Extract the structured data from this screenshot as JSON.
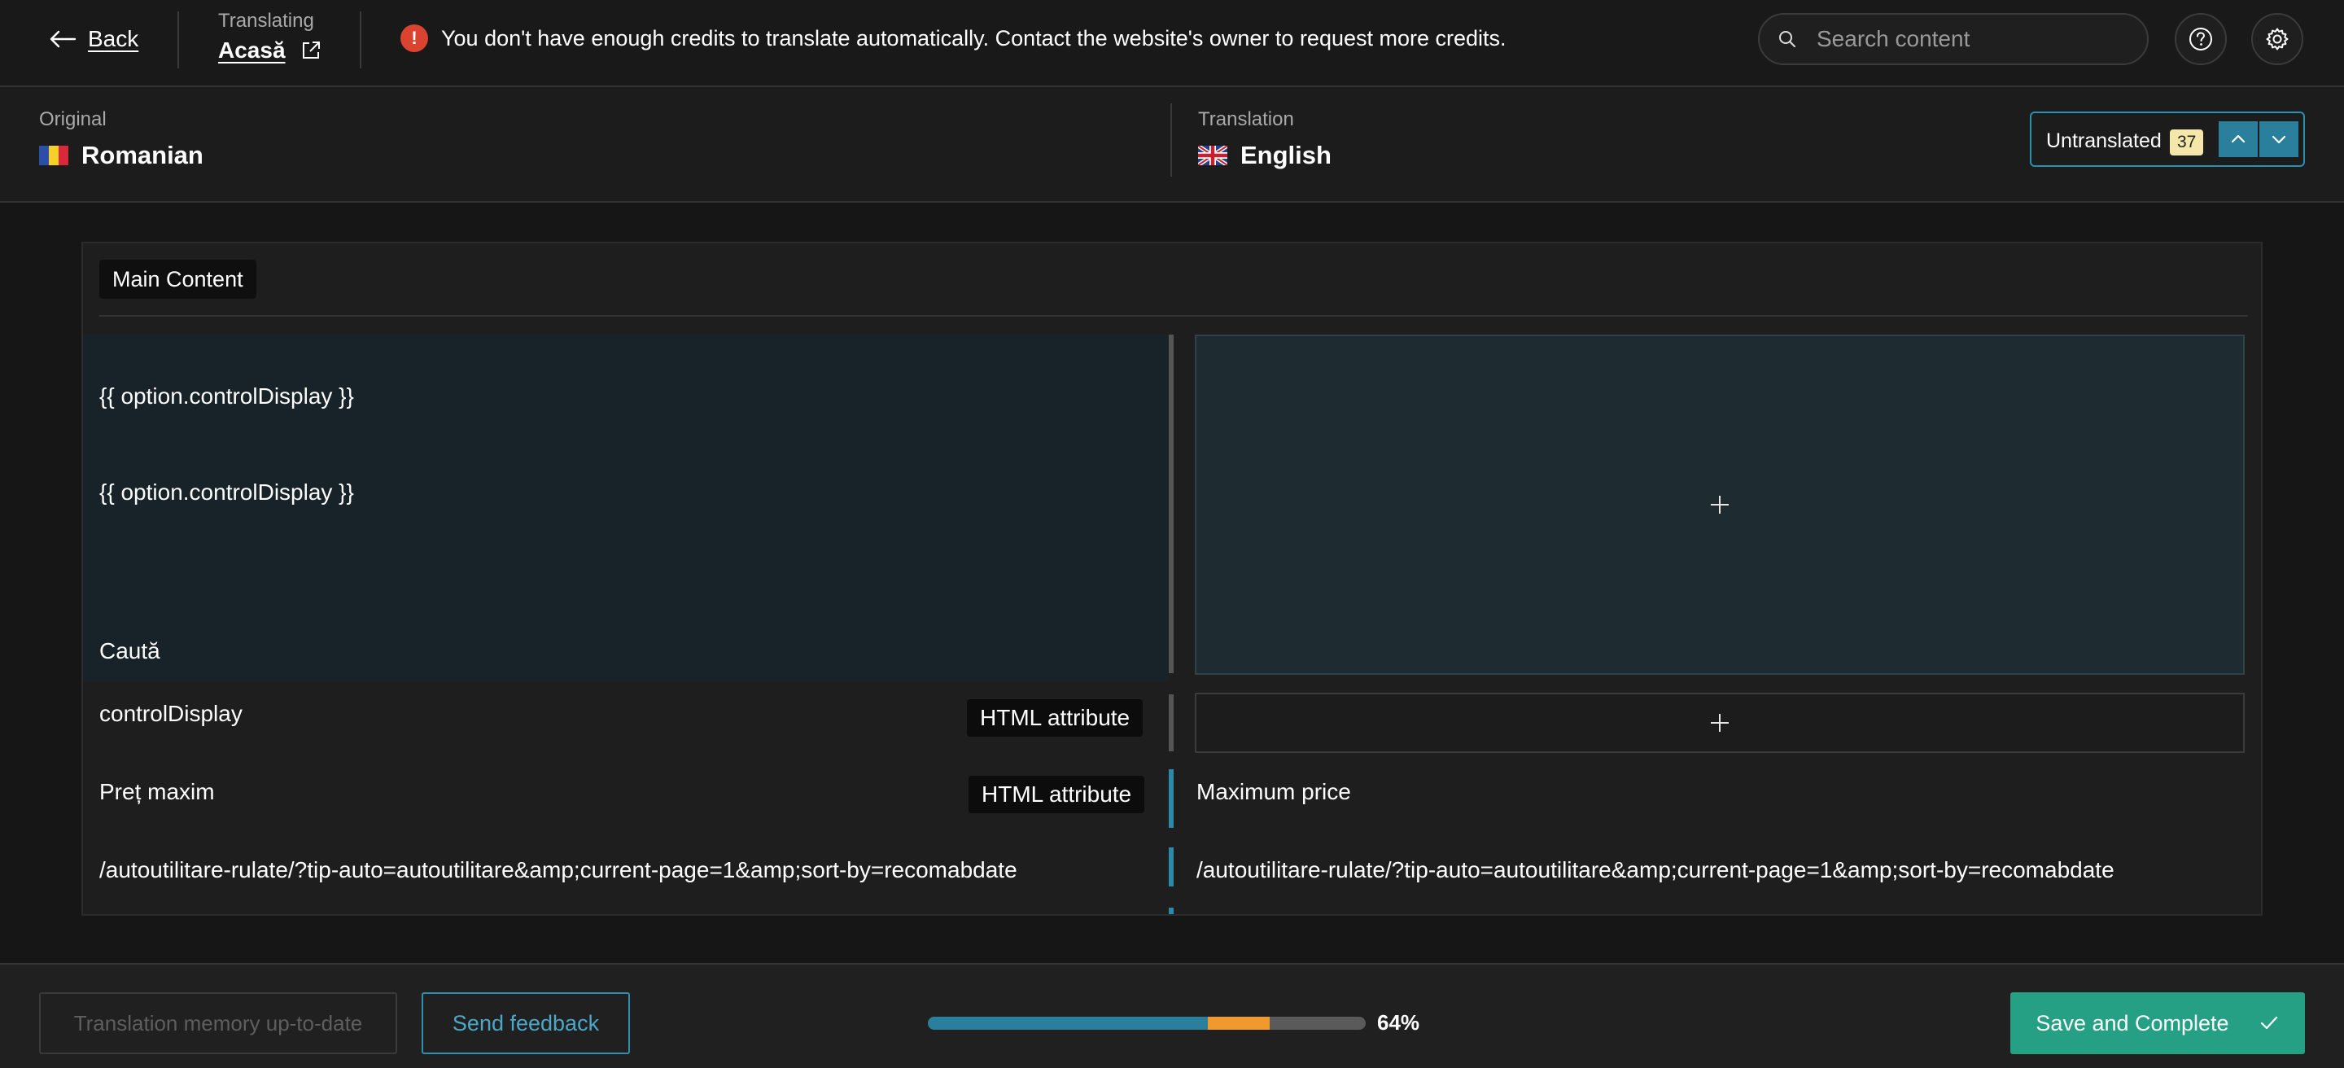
{
  "topbar": {
    "back_label": "Back",
    "translating_label": "Translating",
    "page_name": "Acasă",
    "alert_message": "You don't have enough credits to translate automatically. Contact the website's owner to request more credits.",
    "alert_icon": "!",
    "search_placeholder": "Search content"
  },
  "languages": {
    "original_label": "Original",
    "original_name": "Romanian",
    "translation_label": "Translation",
    "translation_name": "English",
    "untranslated_label": "Untranslated",
    "untranslated_count": "37"
  },
  "main": {
    "section_label": "Main Content",
    "rows": [
      {
        "source_lines": [
          "{{ option.controlDisplay }}",
          "{{ option.controlDisplay }}",
          "Caută"
        ],
        "translation": ""
      },
      {
        "source": "controlDisplay",
        "badge": "HTML attribute",
        "translation": ""
      },
      {
        "source": "Preț maxim",
        "badge": "HTML attribute",
        "translation": "Maximum price"
      },
      {
        "source": "/autoutilitare-rulate/?tip-auto=autoutilitare&amp;current-page=1&amp;sort-by=recomabdate",
        "translation": "/autoutilitare-rulate/?tip-auto=autoutilitare&amp;current-page=1&amp;sort-by=recomabdate"
      }
    ]
  },
  "footer": {
    "memory_button": "Translation memory up-to-date",
    "feedback_button": "Send feedback",
    "progress_label": "64%",
    "progress": {
      "translated": 0.64,
      "fuzzy": 0.14
    },
    "save_button": "Save and Complete"
  },
  "colors": {
    "accent_teal": "#2a7f9c",
    "progress_translated": "#2a7f9c",
    "progress_fuzzy": "#f09a2e",
    "save_green": "#25a085",
    "alert_red": "#d9432f"
  },
  "icons": [
    "arrow-left-icon",
    "external-link-icon",
    "alert-icon",
    "search-icon",
    "help-icon",
    "gear-icon",
    "flag-ro-icon",
    "flag-uk-icon",
    "chevron-up-icon",
    "chevron-down-icon",
    "plus-icon",
    "check-icon"
  ]
}
